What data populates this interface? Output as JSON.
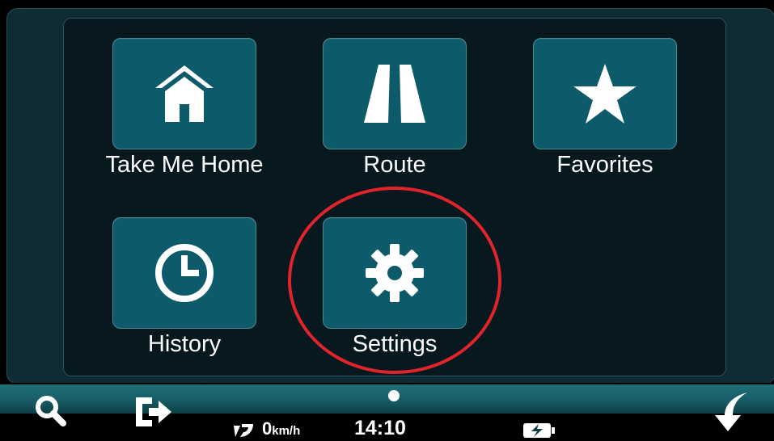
{
  "menu": {
    "tiles": [
      {
        "label": "Take Me Home",
        "icon": "home-icon"
      },
      {
        "label": "Route",
        "icon": "road-icon"
      },
      {
        "label": "Favorites",
        "icon": "star-icon"
      },
      {
        "label": "History",
        "icon": "clock-icon"
      },
      {
        "label": "Settings",
        "icon": "gear-icon",
        "highlighted": true
      }
    ]
  },
  "status_bar": {
    "speed_value": "0",
    "speed_unit": "km/h",
    "time": "14:10",
    "page_indicator": "1"
  },
  "colors": {
    "tile_background": "#0c5a6a",
    "panel_background": "#07181e",
    "highlight": "#e0242a",
    "bar_teal": "#1f6f79"
  }
}
